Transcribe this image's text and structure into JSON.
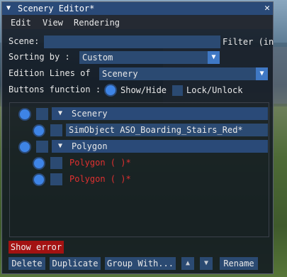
{
  "window": {
    "title": "Scenery Editor*",
    "collapse_icon": "triangle-down-icon",
    "close_icon": "close-icon"
  },
  "menu": [
    "Edit",
    "View",
    "Rendering"
  ],
  "scene": {
    "label": "Scene:",
    "value": "",
    "filter_label": "Filter (in"
  },
  "sorting": {
    "label": "Sorting by :",
    "value": "Custom"
  },
  "edition_lines": {
    "label": "Edition Lines of",
    "value": "Scenery"
  },
  "buttons_function": {
    "label": "Buttons function :",
    "option_1": "Show/Hide",
    "option_2": "Lock/Unlock",
    "selected": "Show/Hide"
  },
  "tree": {
    "groups": [
      {
        "label": "Scenery",
        "items": [
          {
            "label": "SimObject ASO_Boarding_Stairs_Red*",
            "error": false
          }
        ]
      },
      {
        "label": "Polygon",
        "items": [
          {
            "label": "Polygon  ( )*",
            "error": true
          },
          {
            "label": "Polygon  ( )*",
            "error": true
          }
        ]
      }
    ]
  },
  "show_error_label": "Show error",
  "footer_buttons": {
    "delete": "Delete",
    "duplicate": "Duplicate",
    "group_with": "Group With...",
    "rename": "Rename"
  },
  "colors": {
    "title_bar": "#2a4a78",
    "field_bg": "#2b4a72",
    "accent": "#3e84e6",
    "error_text": "#e03030",
    "error_button": "#a31212"
  }
}
